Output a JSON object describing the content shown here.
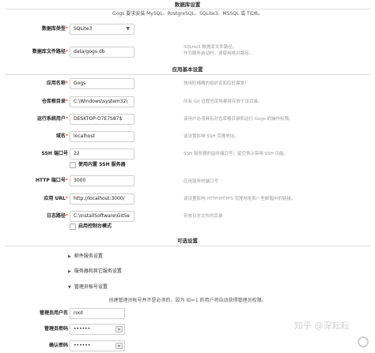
{
  "database": {
    "section_title": "数据库设置",
    "intro": "Gogs 要求安装 MySQL、PostgreSQL、SQLite3、MSSQL 或 TiDB。",
    "type_label": "数据库类型",
    "type_value": "SQLite3",
    "path_label": "数据库文件路径",
    "path_value": "data/gogs.db",
    "path_help_1": "SQLite3 数据库文件路径。",
    "path_help_2": "作为服务启动时，请使用绝对路径。"
  },
  "general": {
    "section_title": "应用基本设置",
    "app_name_label": "应用名称",
    "app_name_value": "Gogs",
    "app_name_help": "快用旺掩搬的组织名和应旺爆发！",
    "repo_root_label": "仓库根目录",
    "repo_root_value": "C:\\Windows\\system32\\",
    "repo_root_help": "所有 Git 远程仓库将都将存放于该目录。",
    "run_user_label": "运行系统用户",
    "run_user_value": "DESKTOP-O7E7S87$",
    "run_user_help": "该用户必须具有对仓库根目录和运行 Gogs 的操作权限。",
    "domain_label": "域名",
    "domain_value": "localhost",
    "domain_help": "该设置影响 SSH 克隆地址。",
    "ssh_port_label": "SSH 端口号",
    "ssh_port_value": "22",
    "ssh_port_help": "SSH 服务器的监听端口号，留空表示禁用 SSH 功能。",
    "builtin_ssh_label": "使用内置 SSH 服务器",
    "http_port_label": "HTTP 端口号",
    "http_port_value": "3000",
    "http_port_help": "应用监听的端口号",
    "app_url_label": "应用 URL",
    "app_url_value": "http://localhost:3000/",
    "app_url_help": "该设置影响 HTTP/HTTPS 克隆地址和一些邮箱中的链接。",
    "log_path_label": "日志路径",
    "log_path_value": "C:\\InstallSoftware\\GitSe",
    "log_path_help": "存放日志文件的目录",
    "console_mode_label": "启用控制台模式"
  },
  "optional": {
    "section_title": "可选设置",
    "email_label": "邮件服务设置",
    "server_label": "服务器和其它服务设置",
    "admin_label": "管理员帐号设置",
    "admin_note": "创建管理员帐号并不是必须的，因为 ID=1 的用户将自动获得管理员权限。",
    "admin_user_label": "管理员用户名",
    "admin_user_value": "root",
    "admin_password_label": "管理员密码",
    "admin_password_value": "••••••",
    "confirm_password_label": "确认密码",
    "confirm_password_value": "••••••"
  },
  "watermark": {
    "zhihu_text": "知乎 @深耘耘"
  }
}
